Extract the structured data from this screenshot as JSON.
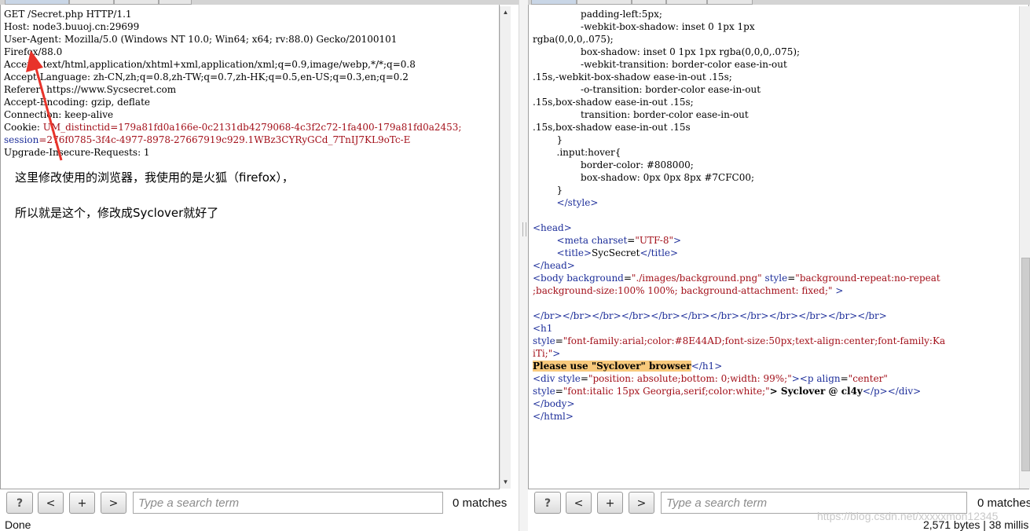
{
  "request": {
    "lines": [
      "GET /Secret.php HTTP/1.1",
      "Host: node3.buuoj.cn:29699",
      "User-Agent: Mozilla/5.0 (Windows NT 10.0; Win64; x64; rv:88.0) Gecko/20100101",
      "Firefox/88.0",
      "Accept: text/html,application/xhtml+xml,application/xml;q=0.9,image/webp,*/*;q=0.8",
      "Accept-Language: zh-CN,zh;q=0.8,zh-TW;q=0.7,zh-HK;q=0.5,en-US;q=0.3,en;q=0.2",
      "Referer: https://www.Sycsecret.com",
      "Accept-Encoding: gzip, deflate",
      "Connection: keep-alive"
    ],
    "cookie_prefix": "Cookie: ",
    "cookie_value": "UM_distinctid=179a81fd0a166e-0c2131db4279068-4c3f2c72-1fa400-179a81fd0a2453;",
    "session_key": "session",
    "session_value": "=276f0785-3f4c-4977-8978-27667919c929.1WBz3CYRyGCd_7TnIJ7KL9oTc-E",
    "last_line": "Upgrade-Insecure-Requests: 1"
  },
  "annotation": {
    "line1": "这里修改使用的浏览器，我使用的是火狐（firefox），",
    "line2": "所以就是这个，修改成Syclover就好了",
    "arrow_color": "#e8332a"
  },
  "response": {
    "css_lines": [
      "                padding-left:5px;",
      "                -webkit-box-shadow: inset 0 1px 1px",
      "rgba(0,0,0,.075);",
      "                box-shadow: inset 0 1px 1px rgba(0,0,0,.075);",
      "                -webkit-transition: border-color ease-in-out",
      ".15s,-webkit-box-shadow ease-in-out .15s;",
      "                -o-transition: border-color ease-in-out",
      ".15s,box-shadow ease-in-out .15s;",
      "                transition: border-color ease-in-out",
      ".15s,box-shadow ease-in-out .15s",
      "        }",
      "        .input:hover{",
      "                border-color: #808000;",
      "                box-shadow: 0px 0px 8px #7CFC00;",
      "        }"
    ],
    "style_close": "</style>",
    "head_open": "<head>",
    "meta_tag": "<meta",
    "meta_attr": "charset",
    "meta_value": "\"UTF-8\"",
    "title_open": "<title>",
    "title_text": "SycSecret",
    "title_close": "</title>",
    "head_close": "</head>",
    "body_open": "<body",
    "body_attr1": "background",
    "body_val1": "\"./images/background.png\"",
    "body_attr2": "style",
    "body_val2a": "\"background-repeat:no-repeat",
    "body_val2b": ";background-size:100% 100%; background-attachment: fixed;\"",
    "body_end": " >",
    "br_line": "</br></br></br></br></br></br></br></br></br></br></br></br>",
    "h1_open": "<h1",
    "h1_attr": "style",
    "h1_val_a": "\"font-family:arial;color:#8E44AD;font-size:50px;text-align:center;font-family:Ka",
    "h1_val_b": "iTi;\"",
    "h1_tail": ">",
    "h1_text": "Please use \"Syclover\" browser",
    "h1_close": "</h1>",
    "div_open": "<div",
    "div_attr": "style",
    "div_val": "\"position: absolute;bottom: 0;width: 99%;\"",
    "p_open": "><p",
    "p_attr": "align",
    "p_val": "\"center\"",
    "p_attr2": "style",
    "p_val2": "\"font:italic 15px Georgia,serif;color:white;\"",
    "p_text": "> Syclover @ cl4y",
    "p_close": "</p></div>",
    "body_close": "</body>",
    "html_close": "</html>"
  },
  "toolbar": {
    "help": "?",
    "prev": "<",
    "add": "+",
    "next": ">",
    "search_placeholder": "Type a search term",
    "matches": "0 matches"
  },
  "status": {
    "left": "Done",
    "right": "2,571 bytes | 38 millis"
  },
  "watermark": "https://blog.csdn.net/xxxxxmon12345"
}
